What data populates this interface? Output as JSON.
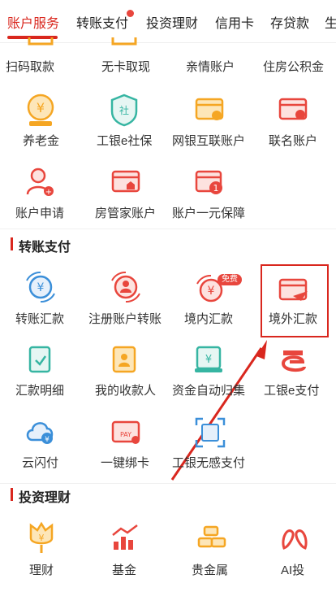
{
  "tabs": [
    "账户服务",
    "转账支付",
    "投资理财",
    "信用卡",
    "存贷款",
    "生"
  ],
  "rows": {
    "row1": [
      "扫码取款",
      "无卡取现",
      "亲情账户",
      "住房公积金"
    ],
    "row2": [
      "养老金",
      "工银e社保",
      "网银互联账户",
      "联名账户"
    ],
    "row3": [
      "账户申请",
      "房管家账户",
      "账户一元保障"
    ],
    "transfer_title": "转账支付",
    "row4": [
      "转账汇款",
      "注册账户转账",
      "境内汇款",
      "境外汇款"
    ],
    "row5": [
      "汇款明细",
      "我的收款人",
      "资金自动归集",
      "工银e支付"
    ],
    "row6": [
      "云闪付",
      "一键绑卡",
      "工银无感支付"
    ],
    "invest_title": "投资理财",
    "row7": [
      "理财",
      "基金",
      "贵金属",
      "AI投"
    ]
  },
  "badge": "免费",
  "colors": {
    "accent": "#d9271e",
    "orange": "#f5a623",
    "teal": "#36b5a2",
    "blue": "#3b8fd9"
  }
}
